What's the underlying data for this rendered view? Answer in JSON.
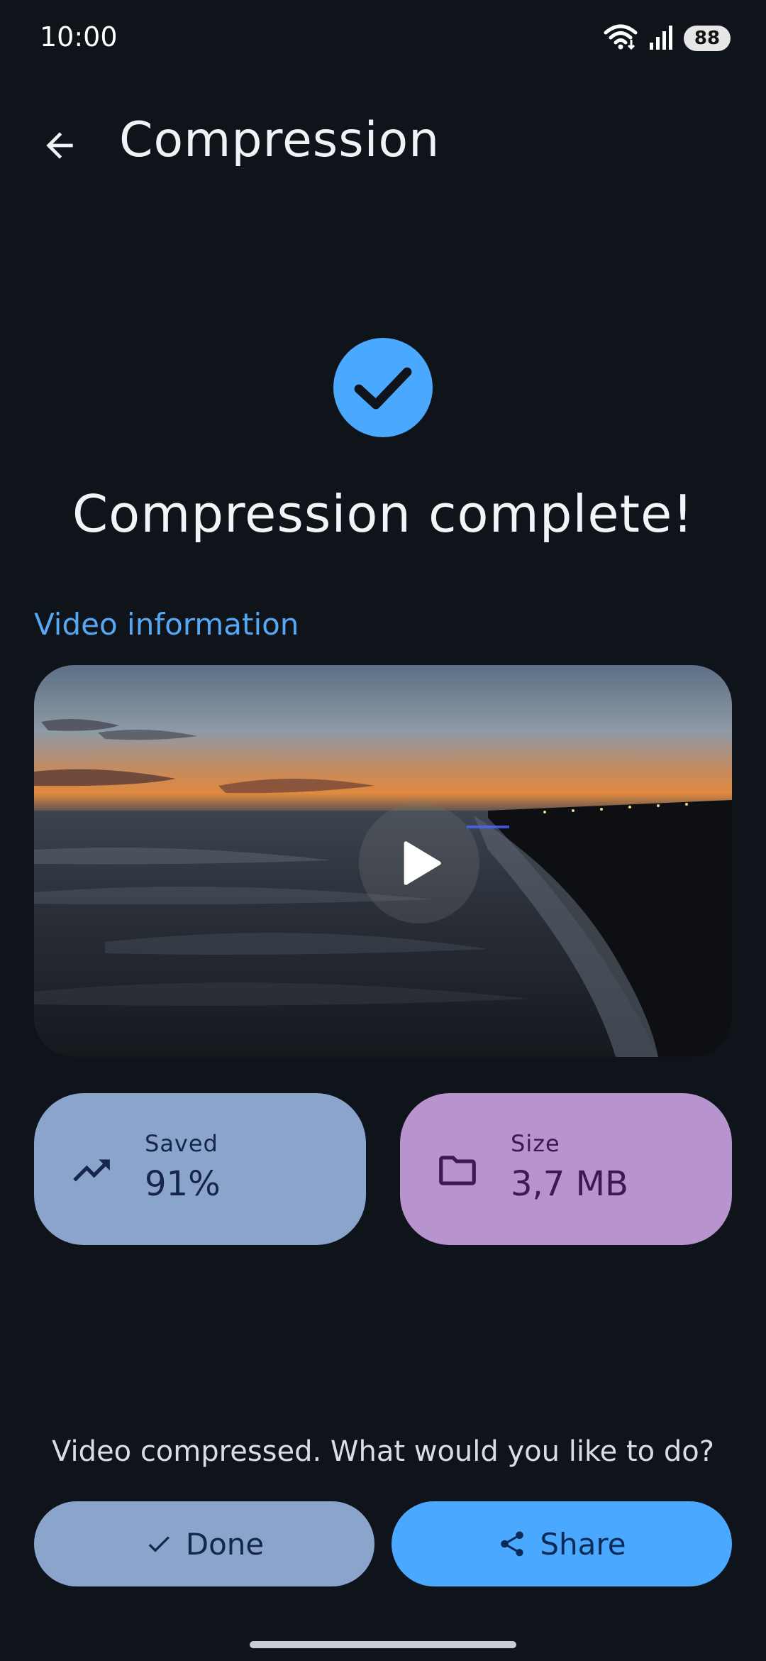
{
  "status_bar": {
    "time": "10:00",
    "battery": "88"
  },
  "app_bar": {
    "title": "Compression"
  },
  "result": {
    "headline": "Compression complete!",
    "section_label": "Video information"
  },
  "stats": {
    "saved_label": "Saved",
    "saved_value": "91%",
    "size_label": "Size",
    "size_value": "3,7 MB"
  },
  "footer": {
    "prompt": "Video compressed. What would you like to do?",
    "done_label": "Done",
    "share_label": "Share"
  },
  "colors": {
    "background": "#0f131a",
    "accent": "#4aa8ff",
    "saved_card": "#8aa4cc",
    "size_card": "#b794ce"
  }
}
